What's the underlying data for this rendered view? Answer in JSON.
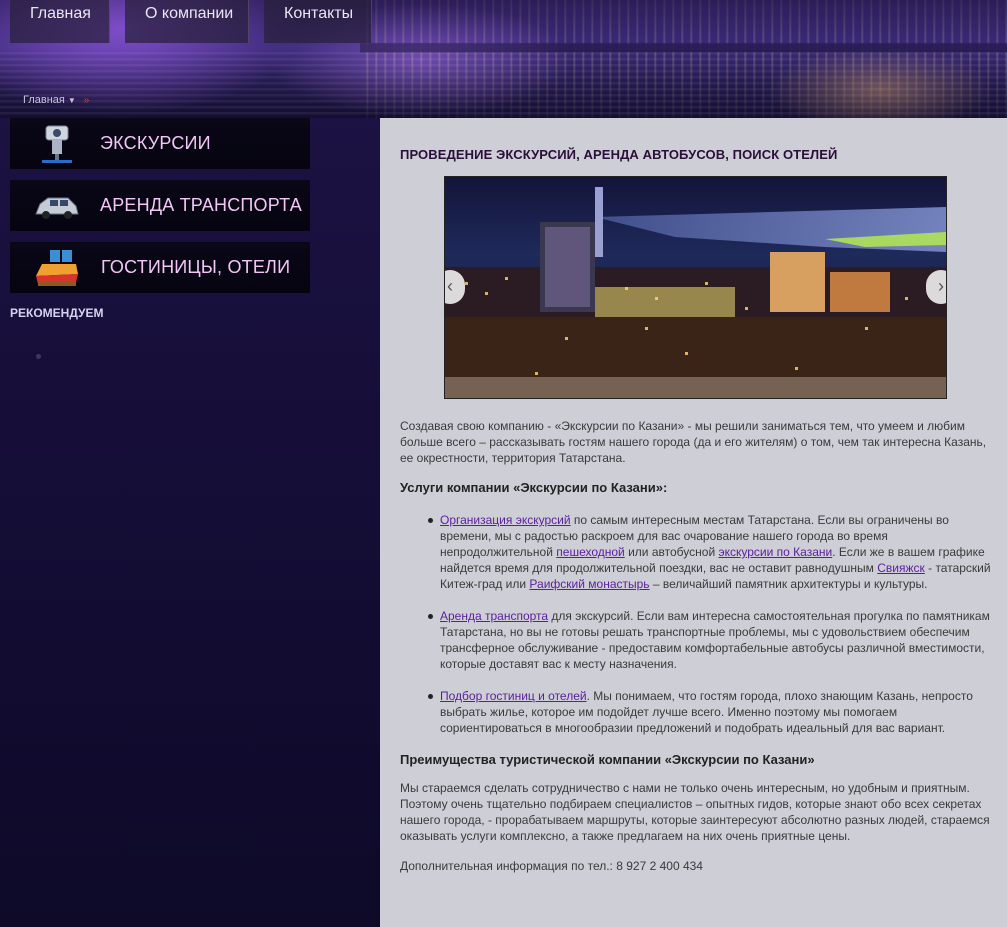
{
  "topnav": {
    "items": [
      {
        "label": "Главная"
      },
      {
        "label": "О компании"
      },
      {
        "label": "Контакты"
      }
    ]
  },
  "breadcrumb": {
    "home": "Главная",
    "separator": "»"
  },
  "sidebar": {
    "menu": [
      {
        "label": "ЭКСКУРСИИ",
        "icon": "camera-icon"
      },
      {
        "label": "АРЕНДА ТРАНСПОРТА",
        "icon": "car-icon"
      },
      {
        "label": "ГОСТИНИЦЫ, ОТЕЛИ",
        "icon": "bed-icon"
      }
    ],
    "recommend_title": "РЕКОМЕНДУЕМ"
  },
  "main": {
    "title": "ПРОВЕДЕНИЕ ЭКСКУРСИЙ, АРЕНДА АВТОБУСОВ, ПОИСК ОТЕЛЕЙ",
    "intro": "Создавая свою компанию - «Экскурсии по Казани» - мы решили заниматься тем, что умеем и любим больше всего – рассказывать гостям нашего города (да и его жителям) о том, чем так интересна Казань, ее окрестности, территория Татарстана.",
    "services_heading": "Услуги компании «Экскурсии по Казани»:",
    "service1": {
      "link1": "Организация экскурсий",
      "text1": " по самым интересным местам Татарстана. Если вы ограничены во времени, мы с радостью раскроем для вас очарование нашего города во время непродолжительной ",
      "link2": "пешеходной",
      "text2": " или автобусной ",
      "link3": "экскурсии по Казани",
      "text3": ". Если же в вашем графике найдется время для продолжительной поездки, вас не оставит равнодушным ",
      "link4": "Свияжск",
      "text4": " - татарский Китеж-град или ",
      "link5": "Раифский монастырь",
      "text5": " – величайший памятник архитектуры и культуры."
    },
    "service2": {
      "link1": "Аренда транспорта",
      "text1": " для экскурсий. Если вам интересна самостоятельная прогулка по памятникам Татарстана, но вы не готовы решать транспортные проблемы, мы с удовольствием обеспечим трансферное обслуживание - предоставим комфортабельные автобусы различной вместимости, которые доставят вас к месту назначения."
    },
    "service3": {
      "link1": "Подбор гостиниц и отелей",
      "text1": ". Мы понимаем, что гостям города, плохо знающим Казань, непросто выбрать жилье, которое им подойдет лучше всего. Именно поэтому мы помогаем сориентироваться в многообразии предложений и подобрать идеальный для вас вариант."
    },
    "advantages_heading": "Преимущества туристической компании «Экскурсии по Казани»",
    "advantages_text": "Мы стараемся сделать сотрудничество с нами не только очень интересным, но удобным и приятным. Поэтому очень тщательно подбираем специалистов – опытных гидов, которые знают обо всех секретах нашего города, - прорабатываем маршруты, которые заинтересуют абсолютно разных людей, стараемся оказывать услуги комплексно, а также предлагаем на них очень приятные цены.",
    "contact_text": "Дополнительная информация по тел.: 8 927 2 400 434",
    "slider": {
      "prev": "‹",
      "next": "›"
    }
  },
  "colors": {
    "menu_text": "#f3c6f5",
    "main_bg": "#ceced6",
    "link": "#5b1ea1",
    "title": "#2a0f3a"
  }
}
